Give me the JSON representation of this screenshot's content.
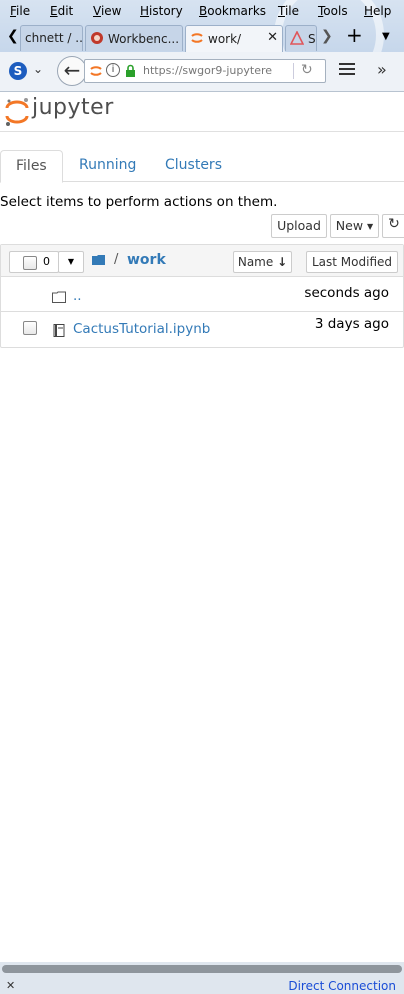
{
  "browser": {
    "menu": [
      "File",
      "Edit",
      "View",
      "History",
      "Bookmarks",
      "Tile",
      "Tools",
      "Help"
    ],
    "tabs": [
      {
        "label": "chnett / ...",
        "active": false
      },
      {
        "label": "Workbenc...",
        "active": false
      },
      {
        "label": "work/",
        "active": true
      },
      {
        "label": "S",
        "active": false
      }
    ],
    "url": "https://swgor9-jupytere",
    "status_text": "Direct Connection",
    "status_close": "✕"
  },
  "jupyter": {
    "logo_text": "jupyter",
    "tabs": [
      "Files",
      "Running",
      "Clusters"
    ],
    "select_hint": "Select items to perform actions on them.",
    "upload_label": "Upload",
    "new_label": "New",
    "selected_count": "0",
    "breadcrumb_sep": "/",
    "breadcrumb_folder": "work",
    "sort_name_label": "Name",
    "sort_modified_label": "Last Modified",
    "items": [
      {
        "name": "..",
        "type": "folder",
        "modified": "seconds ago"
      },
      {
        "name": "CactusTutorial.ipynb",
        "type": "notebook",
        "modified": "3 days ago"
      }
    ]
  },
  "colors": {
    "link": "#337ab7",
    "jupyter_orange": "#f37726",
    "status_link": "#1a4dd6"
  }
}
